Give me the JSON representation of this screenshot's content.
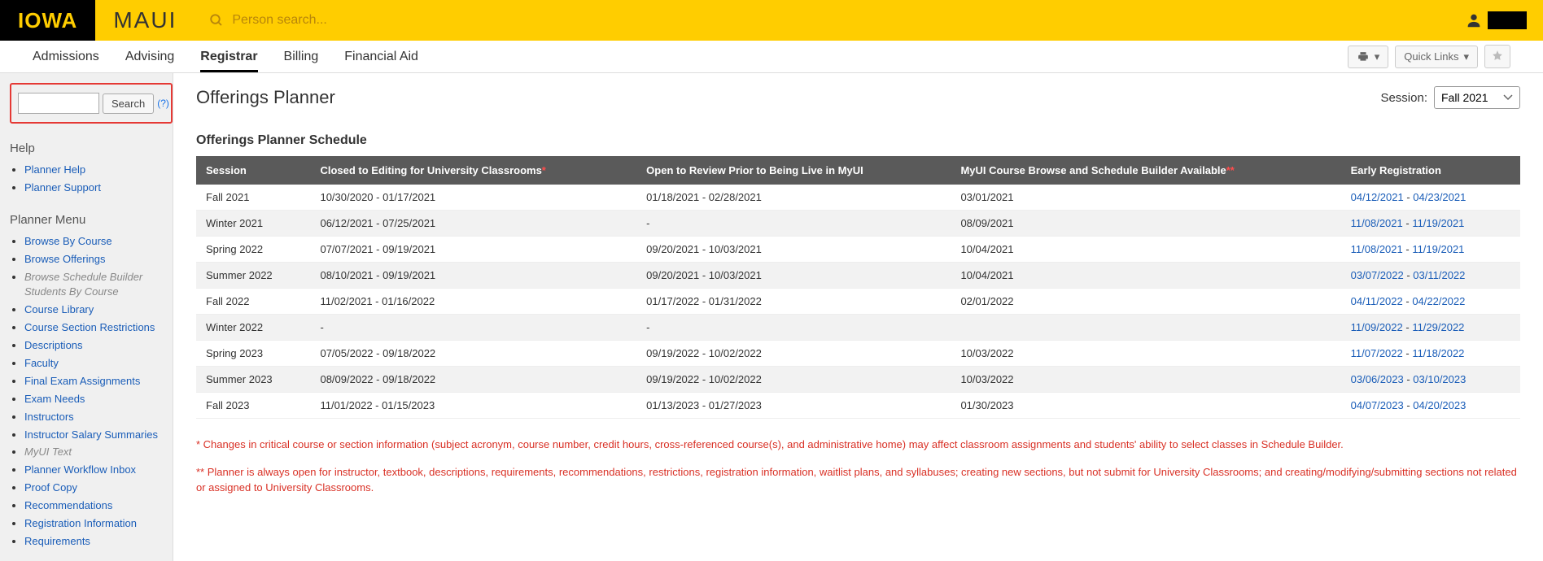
{
  "header": {
    "logo": "IOWA",
    "app": "MAUI",
    "search_placeholder": "Person search..."
  },
  "nav": {
    "tabs": [
      "Admissions",
      "Advising",
      "Registrar",
      "Billing",
      "Financial Aid"
    ],
    "active": "Registrar",
    "quick_links": "Quick Links"
  },
  "sidebar": {
    "search_button": "Search",
    "help_link_text": "(?)",
    "help_heading": "Help",
    "help_links": [
      "Planner Help",
      "Planner Support"
    ],
    "planner_heading": "Planner Menu",
    "planner_items": [
      {
        "label": "Browse By Course",
        "type": "link"
      },
      {
        "label": "Browse Offerings",
        "type": "link"
      },
      {
        "label": "Browse Schedule Builder Students By Course",
        "type": "muted"
      },
      {
        "label": "Course Library",
        "type": "link"
      },
      {
        "label": "Course Section Restrictions",
        "type": "link"
      },
      {
        "label": "Descriptions",
        "type": "link"
      },
      {
        "label": "Faculty",
        "type": "link"
      },
      {
        "label": "Final Exam Assignments",
        "type": "link"
      },
      {
        "label": "Exam Needs",
        "type": "link"
      },
      {
        "label": "Instructors",
        "type": "link"
      },
      {
        "label": "Instructor Salary Summaries",
        "type": "link"
      },
      {
        "label": "MyUI Text",
        "type": "muted"
      },
      {
        "label": "Planner Workflow Inbox",
        "type": "link"
      },
      {
        "label": "Proof Copy",
        "type": "link"
      },
      {
        "label": "Recommendations",
        "type": "link"
      },
      {
        "label": "Registration Information",
        "type": "link"
      },
      {
        "label": "Requirements",
        "type": "link"
      }
    ]
  },
  "content": {
    "title": "Offerings Planner",
    "session_label": "Session:",
    "session_value": "Fall 2021",
    "schedule_heading": "Offerings Planner Schedule",
    "columns": [
      "Session",
      "Closed to Editing for University Classrooms",
      "Open to Review Prior to Being Live in MyUI",
      "MyUI Course Browse and Schedule Builder Available",
      "Early Registration"
    ],
    "col_asterisk": {
      "1": "*",
      "3": "**"
    },
    "rows": [
      {
        "session": "Fall 2021",
        "closed": "10/30/2020  -  01/17/2021",
        "open": "01/18/2021  -  02/28/2021",
        "myui": "03/01/2021",
        "reg_a": "04/12/2021",
        "reg_b": "04/23/2021"
      },
      {
        "session": "Winter 2021",
        "closed": "06/12/2021  -  07/25/2021",
        "open": "  -  ",
        "myui": "08/09/2021",
        "reg_a": "11/08/2021",
        "reg_b": "11/19/2021"
      },
      {
        "session": "Spring 2022",
        "closed": "07/07/2021  -  09/19/2021",
        "open": "09/20/2021  -  10/03/2021",
        "myui": "10/04/2021",
        "reg_a": "11/08/2021",
        "reg_b": "11/19/2021"
      },
      {
        "session": "Summer 2022",
        "closed": "08/10/2021  -  09/19/2021",
        "open": "09/20/2021  -  10/03/2021",
        "myui": "10/04/2021",
        "reg_a": "03/07/2022",
        "reg_b": "03/11/2022"
      },
      {
        "session": "Fall 2022",
        "closed": "11/02/2021  -  01/16/2022",
        "open": "01/17/2022  -  01/31/2022",
        "myui": "02/01/2022",
        "reg_a": "04/11/2022",
        "reg_b": "04/22/2022"
      },
      {
        "session": "Winter 2022",
        "closed": "  -  ",
        "open": "  -  ",
        "myui": "",
        "reg_a": "11/09/2022",
        "reg_b": "11/29/2022"
      },
      {
        "session": "Spring 2023",
        "closed": "07/05/2022  -  09/18/2022",
        "open": "09/19/2022  -  10/02/2022",
        "myui": "10/03/2022",
        "reg_a": "11/07/2022",
        "reg_b": "11/18/2022"
      },
      {
        "session": "Summer 2023",
        "closed": "08/09/2022  -  09/18/2022",
        "open": "09/19/2022  -  10/02/2022",
        "myui": "10/03/2022",
        "reg_a": "03/06/2023",
        "reg_b": "03/10/2023"
      },
      {
        "session": "Fall 2023",
        "closed": "11/01/2022  -  01/15/2023",
        "open": "01/13/2023  -  01/27/2023",
        "myui": "01/30/2023",
        "reg_a": "04/07/2023",
        "reg_b": "04/20/2023"
      }
    ],
    "footnote1": "* Changes in critical course or section information (subject acronym, course number, credit hours, cross-referenced course(s), and administrative home) may affect classroom assignments and students' ability to select classes in Schedule Builder.",
    "footnote2": "** Planner is always open for instructor, textbook, descriptions, requirements, recommendations, restrictions, registration information, waitlist plans, and syllabuses; creating new sections, but not submit for University Classrooms; and creating/modifying/submitting sections not related or assigned to University Classrooms."
  }
}
